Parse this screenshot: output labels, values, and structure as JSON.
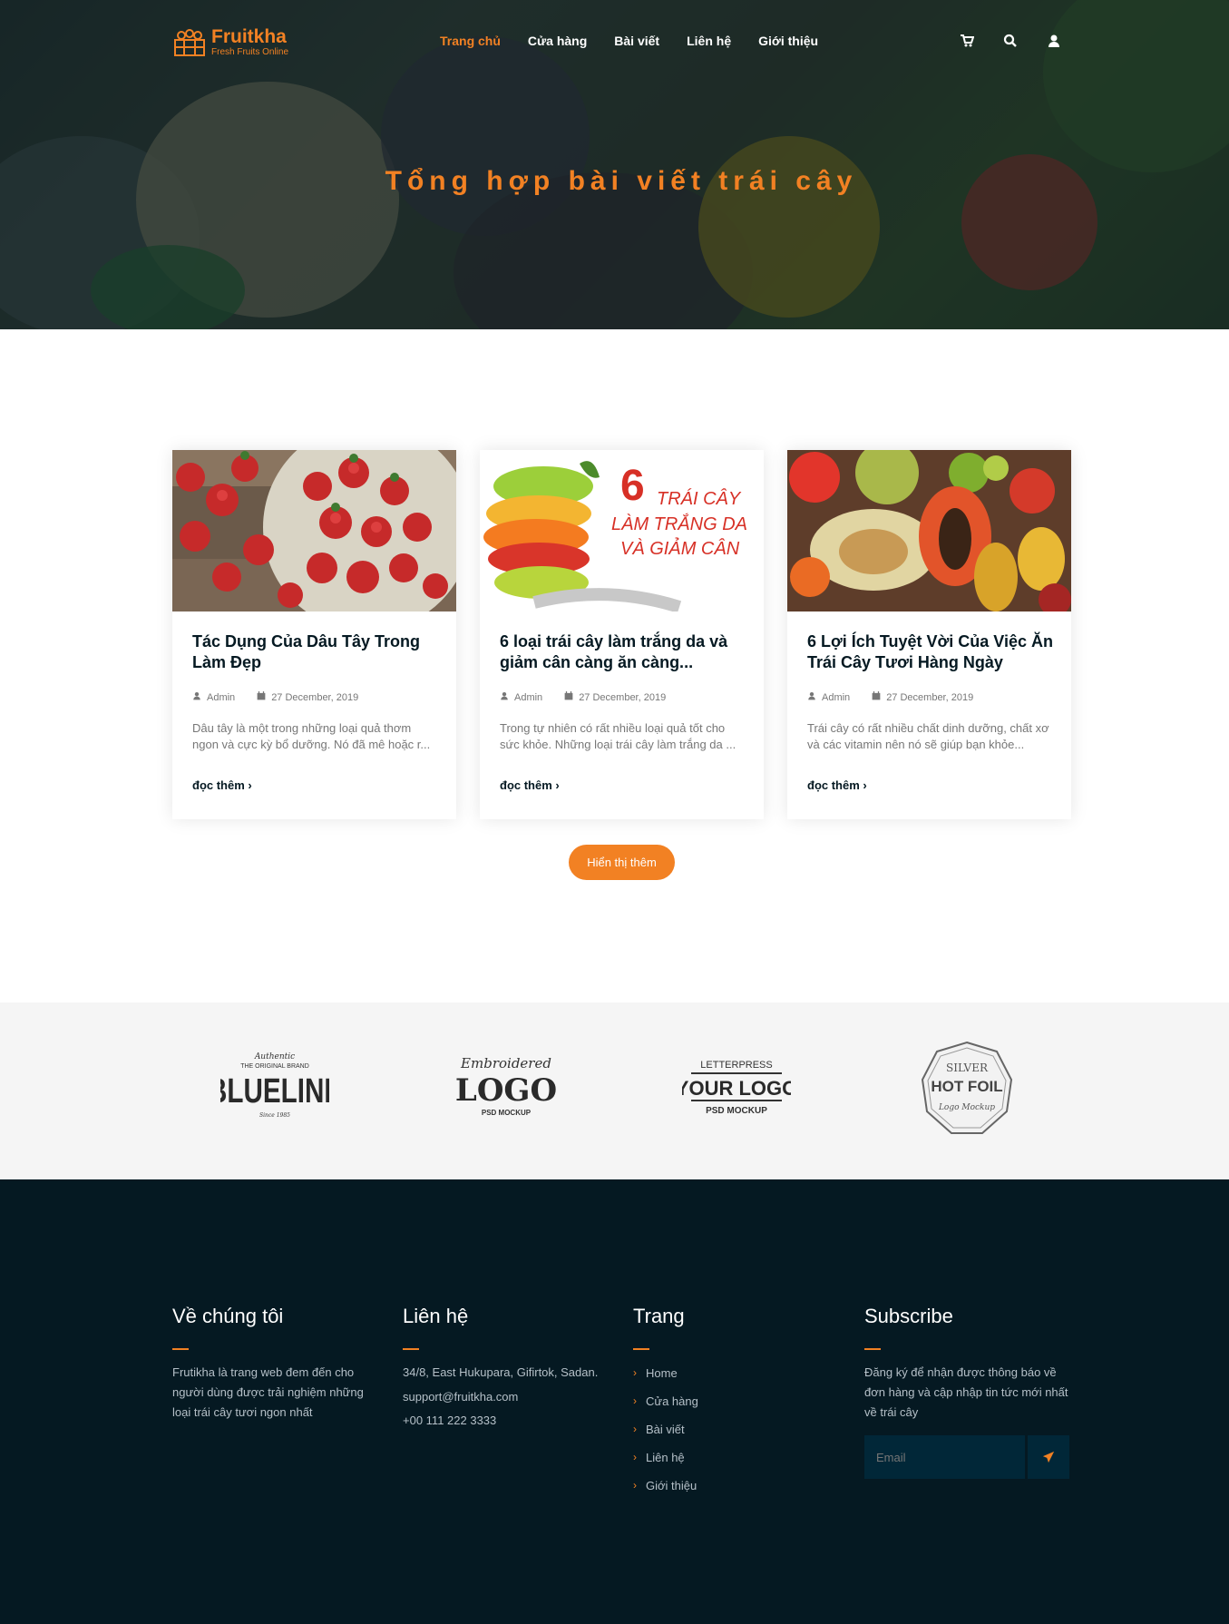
{
  "header": {
    "brand_name": "Fruitkha",
    "brand_tagline": "Fresh Fruits Online",
    "nav": [
      "Trang chủ",
      "Cửa hàng",
      "Bài viết",
      "Liên hệ",
      "Giới thiệu"
    ],
    "active_nav": "Trang chủ",
    "icons": [
      "cart-icon",
      "search-icon",
      "user-icon"
    ]
  },
  "hero": {
    "title": "Tổng hợp bài viết trái cây"
  },
  "posts": [
    {
      "title": "Tác Dụng Của Dâu Tây Trong Làm Đẹp",
      "author": "Admin",
      "date": "27 December, 2019",
      "excerpt": "Dâu tây là một trong những loại quả thơm ngon và cực kỳ bổ dưỡng. Nó đã mê hoặc r...",
      "read_more": "đọc thêm"
    },
    {
      "title": "6 loại trái cây làm trắng da và giảm cân càng ăn càng...",
      "author": "Admin",
      "date": "27 December, 2019",
      "excerpt": "Trong tự nhiên có rất nhiều loại quả tốt cho sức khỏe. Những loại trái cây làm trắng da ...",
      "read_more": "đọc thêm",
      "image_text": [
        "6",
        "TRÁI CÂY",
        "LÀM TRẮNG DA",
        "VÀ GIẢM CÂN"
      ]
    },
    {
      "title": "6 Lợi Ích Tuyệt Vời Của Việc Ăn Trái Cây Tươi Hàng Ngày",
      "author": "Admin",
      "date": "27 December, 2019",
      "excerpt": "Trái cây có rất nhiều chất dinh dưỡng, chất xơ và các vitamin nên nó sẽ giúp bạn khỏe...",
      "read_more": "đọc thêm"
    }
  ],
  "show_more_label": "Hiển thị thêm",
  "partner_logos": [
    {
      "name": "BLUELINE",
      "top": "THE ORIGINAL BRAND",
      "script": "Authentic",
      "bottom": "Since 1985"
    },
    {
      "name": "LOGO",
      "script": "Embroidered",
      "bottom": "PSD MOCKUP"
    },
    {
      "name": "YOUR LOGO",
      "top": "LETTERPRESS",
      "bottom": "PSD MOCKUP"
    },
    {
      "name": "HOT FOIL",
      "top": "SILVER",
      "bottom": "Logo Mockup"
    }
  ],
  "footer": {
    "about": {
      "title": "Về chúng tôi",
      "text": "Frutikha là trang web đem đến cho người dùng được trải nghiệm những loại trái cây tươi ngon nhất"
    },
    "contact": {
      "title": "Liên hệ",
      "address": "34/8, East Hukupara, Gifirtok, Sadan.",
      "email": "support@fruitkha.com",
      "phone": "+00 111 222 3333"
    },
    "pages": {
      "title": "Trang",
      "links": [
        "Home",
        "Cửa hàng",
        "Bài viết",
        "Liên hệ",
        "Giới thiệu"
      ]
    },
    "subscribe": {
      "title": "Subscribe",
      "text": "Đăng ký để nhận được thông báo về đơn hàng và cập nhập tin tức mới nhất về trái cây",
      "placeholder": "Email"
    }
  },
  "colors": {
    "accent": "#F28123",
    "dark": "#051922",
    "footer_input": "#012738"
  }
}
